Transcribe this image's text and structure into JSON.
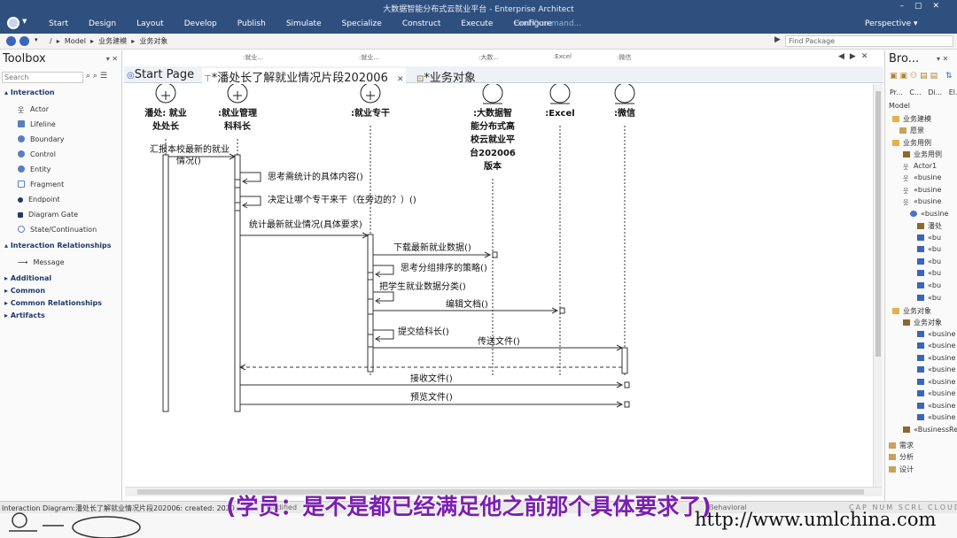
{
  "window": {
    "title": "大数据智能分布式云就业平台 - Enterprise Architect"
  },
  "menu": [
    "Start",
    "Design",
    "Layout",
    "Develop",
    "Publish",
    "Simulate",
    "Specialize",
    "Construct",
    "Execute",
    "Configure"
  ],
  "find_command": "Find Command...",
  "perspective": "Perspective",
  "breadcrumb": {
    "items": [
      "/",
      "Model",
      "业务建模",
      "业务对象"
    ]
  },
  "find_package_placeholder": "Find Package",
  "toolbox": {
    "title": "Toolbox",
    "search_placeholder": "Search",
    "sections": [
      {
        "label": "Interaction",
        "items": [
          "Actor",
          "Lifeline",
          "Boundary",
          "Control",
          "Entity",
          "Fragment",
          "Endpoint",
          "Diagram Gate",
          "State/Continuation"
        ]
      },
      {
        "label": "Interaction Relationships",
        "items": [
          "Message"
        ]
      },
      {
        "label": "Additional",
        "items": []
      },
      {
        "label": "Common",
        "items": []
      },
      {
        "label": "Common Relationships",
        "items": []
      },
      {
        "label": "Artifacts",
        "items": []
      }
    ]
  },
  "strip_labels": [
    ":就业...",
    ":就业...",
    ":大数...",
    ":Excel",
    ":微信"
  ],
  "tabs": [
    "Start Page",
    "*潘处长了解就业情况片段202006",
    "*业务对象"
  ],
  "diagram": {
    "lifelines": [
      {
        "label_lines": [
          "潘处: 就业",
          "处处长"
        ],
        "kind": "actor"
      },
      {
        "label_lines": [
          ":就业管理",
          "科科长"
        ],
        "kind": "actor"
      },
      {
        "label_lines": [
          ":就业专干"
        ],
        "kind": "actor"
      },
      {
        "label_lines": [
          ":大数据智",
          "能分布式高",
          "校云就业平",
          "台202006",
          "版本"
        ],
        "kind": "entity"
      },
      {
        "label_lines": [
          ":Excel"
        ],
        "kind": "entity"
      },
      {
        "label_lines": [
          ":微信"
        ],
        "kind": "entity"
      }
    ],
    "messages": [
      {
        "text": "汇报本校最新的就业情况()"
      },
      {
        "text": "思考需统计的具体内容()"
      },
      {
        "text": "决定让哪个专干来干（在旁边的？）()"
      },
      {
        "text": "统计最新就业情况(具体要求)"
      },
      {
        "text": "下载最新就业数据()"
      },
      {
        "text": "思考分组排序的策略()"
      },
      {
        "text": "把学生就业数据分类()"
      },
      {
        "text": "编辑文档()"
      },
      {
        "text": "提交给科长()"
      },
      {
        "text": "传送文件()"
      },
      {
        "text": ""
      },
      {
        "text": "接收文件()"
      },
      {
        "text": "预览文件()"
      }
    ]
  },
  "browser": {
    "title": "Bro...",
    "tabs": [
      "Pr...",
      "C...",
      "Di...",
      "El..."
    ],
    "nodes": [
      "Model",
      "业务建模",
      "愿景",
      "业务用例",
      "业务用例",
      "Actor1",
      "«busine",
      "«busine",
      "«busine",
      "«busine",
      "潘处",
      "«bu",
      "«bu",
      "«bu",
      "«bu",
      "«bu",
      "«bu",
      "业务对象",
      "业务对象",
      "«busine",
      "«busine",
      "«busine",
      "«busine",
      "«busine",
      "«busine",
      "«busine",
      "«busine",
      "«BusinessRe",
      "需求",
      "分析",
      "设计"
    ]
  },
  "status": {
    "text": "Interaction Diagram:潘处长了解就业情况片段202006:  created: 2020",
    "mid": "modified",
    "mid2": "Behavioral",
    "right": [
      "CAP",
      "NUM",
      "SCRL",
      "CLOUD"
    ]
  },
  "subtitle": "(学员：是不是都已经满足他之前那个具体要求了)",
  "watermark": "http://www.umlchina.com"
}
